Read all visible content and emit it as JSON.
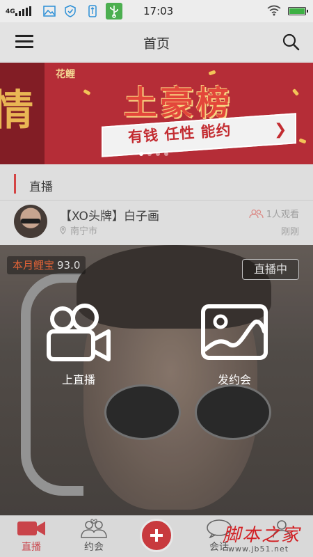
{
  "status_bar": {
    "network": "4G",
    "time": "17:03"
  },
  "header": {
    "title": "首页"
  },
  "banner": {
    "brand": "花鲤",
    "headline": "土豪榜",
    "slogan": "有钱 任性 能约",
    "left_glyph": "情",
    "page_count": 4,
    "active_page": 1
  },
  "section": {
    "title": "直播"
  },
  "live_item": {
    "title": "【XO头牌】白子画",
    "location": "南宁市",
    "viewers": "1人观看",
    "time": "刚刚",
    "tag_label": "本月鲤宝",
    "tag_value": "93.0",
    "status": "直播中"
  },
  "overlay_actions": {
    "go_live": "上直播",
    "post_date": "发约会"
  },
  "tabs": [
    {
      "label": "直播",
      "active": true
    },
    {
      "label": "约会",
      "active": false
    },
    {
      "label": "会话",
      "active": false
    },
    {
      "label": "",
      "active": false
    }
  ],
  "watermark": {
    "title": "脚本之家",
    "url": "www.jb51.net"
  },
  "colors": {
    "accent": "#c83a3e",
    "banner_red": "#b1202b",
    "header_bg": "#e3e3e3"
  }
}
